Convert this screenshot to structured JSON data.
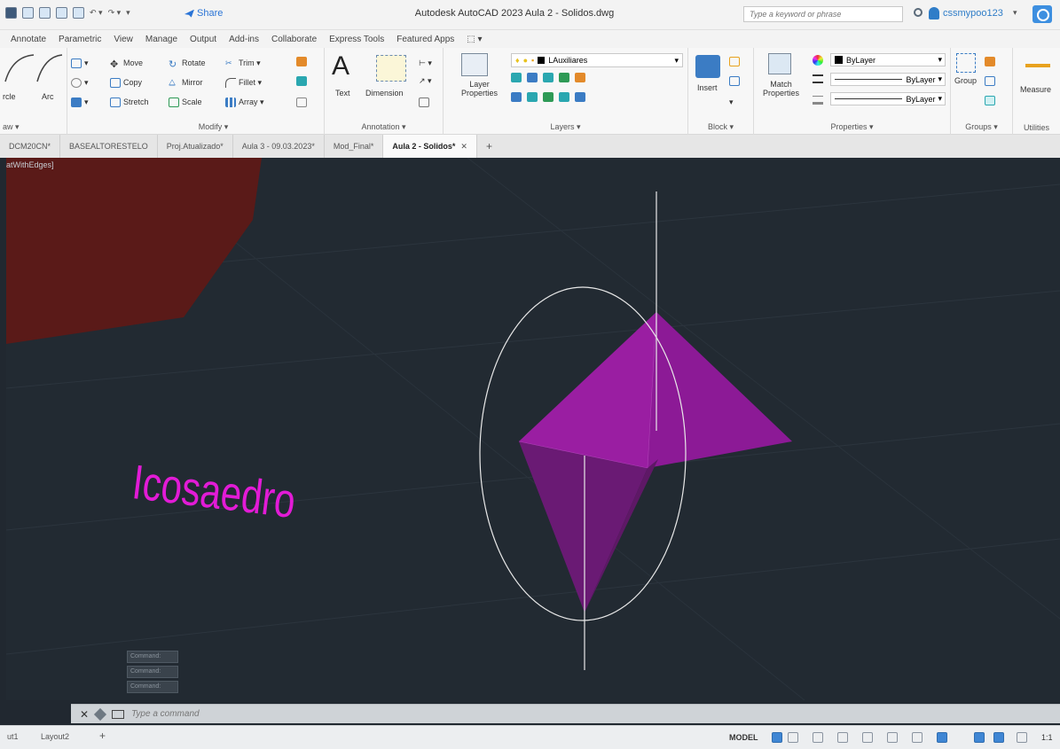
{
  "title_bar": {
    "share_label": "Share",
    "app_title": "Autodesk AutoCAD 2023   Aula 2 - Solidos.dwg",
    "search_placeholder": "Type a keyword or phrase",
    "user_name": "cssmypoo123"
  },
  "ribbon_tabs": [
    "Annotate",
    "Parametric",
    "View",
    "Manage",
    "Output",
    "Add-ins",
    "Collaborate",
    "Express Tools",
    "Featured Apps",
    "⬚ ▾"
  ],
  "ribbon": {
    "draw": {
      "circle": "rcle",
      "arc": "Arc",
      "footer": "aw ▾"
    },
    "modify": {
      "move": "Move",
      "rotate": "Rotate",
      "trim": "Trim ▾",
      "copy": "Copy",
      "mirror": "Mirror",
      "fillet": "Fillet ▾",
      "stretch": "Stretch",
      "scale": "Scale",
      "array": "Array ▾",
      "footer": "Modify ▾"
    },
    "annotation": {
      "text": "Text",
      "dimension": "Dimension",
      "footer": "Annotation ▾"
    },
    "layers": {
      "layer_properties_line1": "Layer",
      "layer_properties_line2": "Properties",
      "current_layer": "LAuxiliares",
      "footer": "Layers ▾"
    },
    "block": {
      "insert": "Insert",
      "footer": "Block ▾"
    },
    "properties": {
      "match_line1": "Match",
      "match_line2": "Properties",
      "color": "ByLayer",
      "linetype": "ByLayer",
      "lineweight": "ByLayer",
      "footer": "Properties ▾"
    },
    "groups": {
      "group": "Group",
      "footer": "Groups ▾"
    },
    "utilities": {
      "measure": "Measure",
      "footer": "Utilities"
    }
  },
  "doc_tabs": [
    {
      "label": "DCM20CN*",
      "active": false
    },
    {
      "label": "BASEALTORESTELO",
      "active": false
    },
    {
      "label": "Proj.Atualizado*",
      "active": false
    },
    {
      "label": "Aula 3 - 09.03.2023*",
      "active": false
    },
    {
      "label": "Mod_Final*",
      "active": false
    },
    {
      "label": "Aula 2 - Solidos*",
      "active": true
    }
  ],
  "viewport": {
    "visual_style_label": "atWithEdges]",
    "text_label": "Icosaedro",
    "cmd_history": [
      "Command:",
      "Command:",
      "Command:"
    ],
    "colors": {
      "background": "#222a32",
      "solid_face_light": "#9a1ea2",
      "solid_face_dark": "#661a70",
      "text": "#e21bd6",
      "region": "#5a1a18"
    }
  },
  "command_line": {
    "placeholder": "Type a command"
  },
  "status_bar": {
    "layout_tabs": [
      "ut1",
      "Layout2",
      "+"
    ],
    "model_label": "MODEL",
    "scale": "1:1"
  }
}
